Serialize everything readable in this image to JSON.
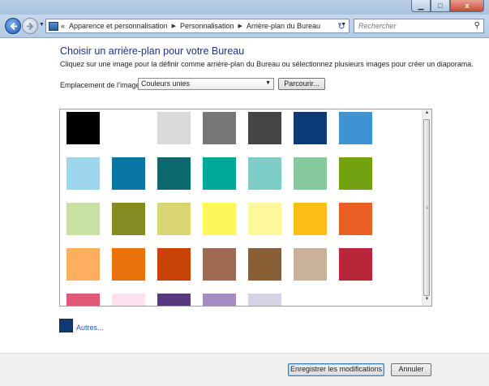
{
  "window": {
    "minimize_glyph": "▁",
    "maximize_glyph": "□",
    "close_glyph": "x"
  },
  "nav": {
    "back_icon": "arrow-left-icon",
    "forward_icon": "arrow-right-icon",
    "breadcrumb_prefix": "«",
    "breadcrumbs": [
      "Apparence et personnalisation",
      "Personnalisation",
      "Arrière-plan du Bureau"
    ],
    "search_placeholder": "Rechercher"
  },
  "page": {
    "title": "Choisir un arrière-plan pour votre Bureau",
    "description": "Cliquez sur une image pour la définir comme arrière-plan du Bureau ou sélectionnez plusieurs images pour créer un diaporama.",
    "location_label": "Emplacement de l’image :",
    "location_value": "Couleurs unies",
    "browse_label": "Parcourir..."
  },
  "swatches": [
    "#000000",
    "#ffffff",
    "#d9d9d9",
    "#777777",
    "#444444",
    "#0c3a78",
    "#3e93d3",
    "#9ed6eb",
    "#0b76a6",
    "#0c6a6e",
    "#00a899",
    "#7ccdc8",
    "#85c99c",
    "#72a111",
    "#c8e0a1",
    "#858b23",
    "#d8d572",
    "#fff55c",
    "#fdf99a",
    "#fdbf16",
    "#ea5f24",
    "#fdae5f",
    "#e8730c",
    "#c64206",
    "#9f6a54",
    "#8a5f36",
    "#c8b29b",
    "#b8263a",
    "#de5878",
    "#fde1ec",
    "#58387e",
    "#a58ac4",
    "#d8d2e7"
  ],
  "others": {
    "color": "#0f3a72",
    "label": "Autres..."
  },
  "footer": {
    "save_label": "Enregistrer les modifications",
    "cancel_label": "Annuler"
  }
}
